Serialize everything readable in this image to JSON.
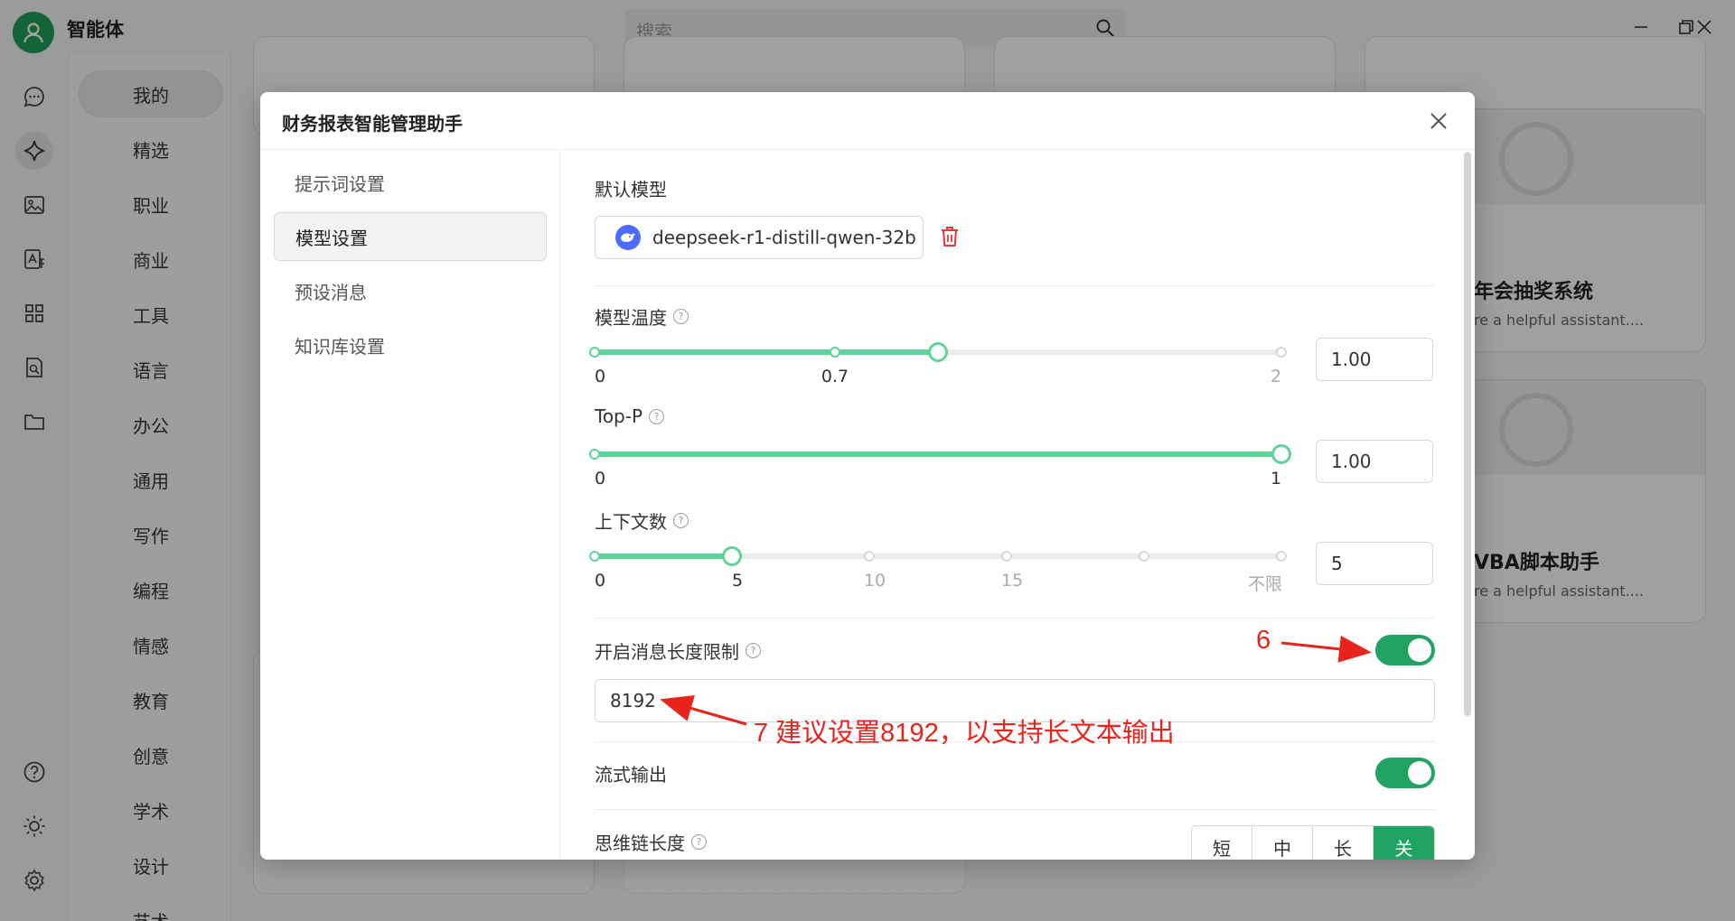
{
  "app": {
    "title": "智能体"
  },
  "search": {
    "placeholder": "搜索"
  },
  "categories": [
    "我的",
    "精选",
    "职业",
    "商业",
    "工具",
    "语言",
    "办公",
    "通用",
    "写作",
    "编程",
    "情感",
    "教育",
    "创意",
    "学术",
    "设计",
    "艺术"
  ],
  "background_cards": [
    {
      "name": "年会抽奖系统",
      "desc": "re a helpful assistant...."
    },
    {
      "name": "VBA脚本助手",
      "desc": "re a helpful assistant...."
    }
  ],
  "modal": {
    "title": "财务报表智能管理助手",
    "tabs": [
      "提示词设置",
      "模型设置",
      "预设消息",
      "知识库设置"
    ],
    "active_tab": "模型设置",
    "default_model": {
      "label": "默认模型",
      "name": "deepseek-r1-distill-qwen-32b"
    },
    "temperature": {
      "label": "模型温度",
      "ticks": [
        "0",
        "0.7",
        "2"
      ],
      "value": "1.00",
      "min": 0,
      "max": 2,
      "slider_value": 1.0
    },
    "top_p": {
      "label": "Top-P",
      "ticks": [
        "0",
        "1"
      ],
      "value": "1.00",
      "min": 0,
      "max": 1,
      "slider_value": 1.0
    },
    "context": {
      "label": "上下文数",
      "ticks": [
        "0",
        "5",
        "10",
        "15",
        "不限"
      ],
      "value": "5",
      "slider_value": 5
    },
    "message_length_limit": {
      "label": "开启消息长度限制",
      "enabled": true,
      "value": "8192"
    },
    "stream_output": {
      "label": "流式输出",
      "enabled": true
    },
    "thinking_length": {
      "label": "思维链长度",
      "options": [
        "短",
        "中",
        "长",
        "关"
      ],
      "selected": "关"
    }
  },
  "annotations": {
    "step6": "6",
    "step7": "7 建议设置8192，以支持长文本输出"
  },
  "colors": {
    "accent": "#1fa463",
    "slider": "#5fd39c",
    "annotation": "#e8241c"
  }
}
